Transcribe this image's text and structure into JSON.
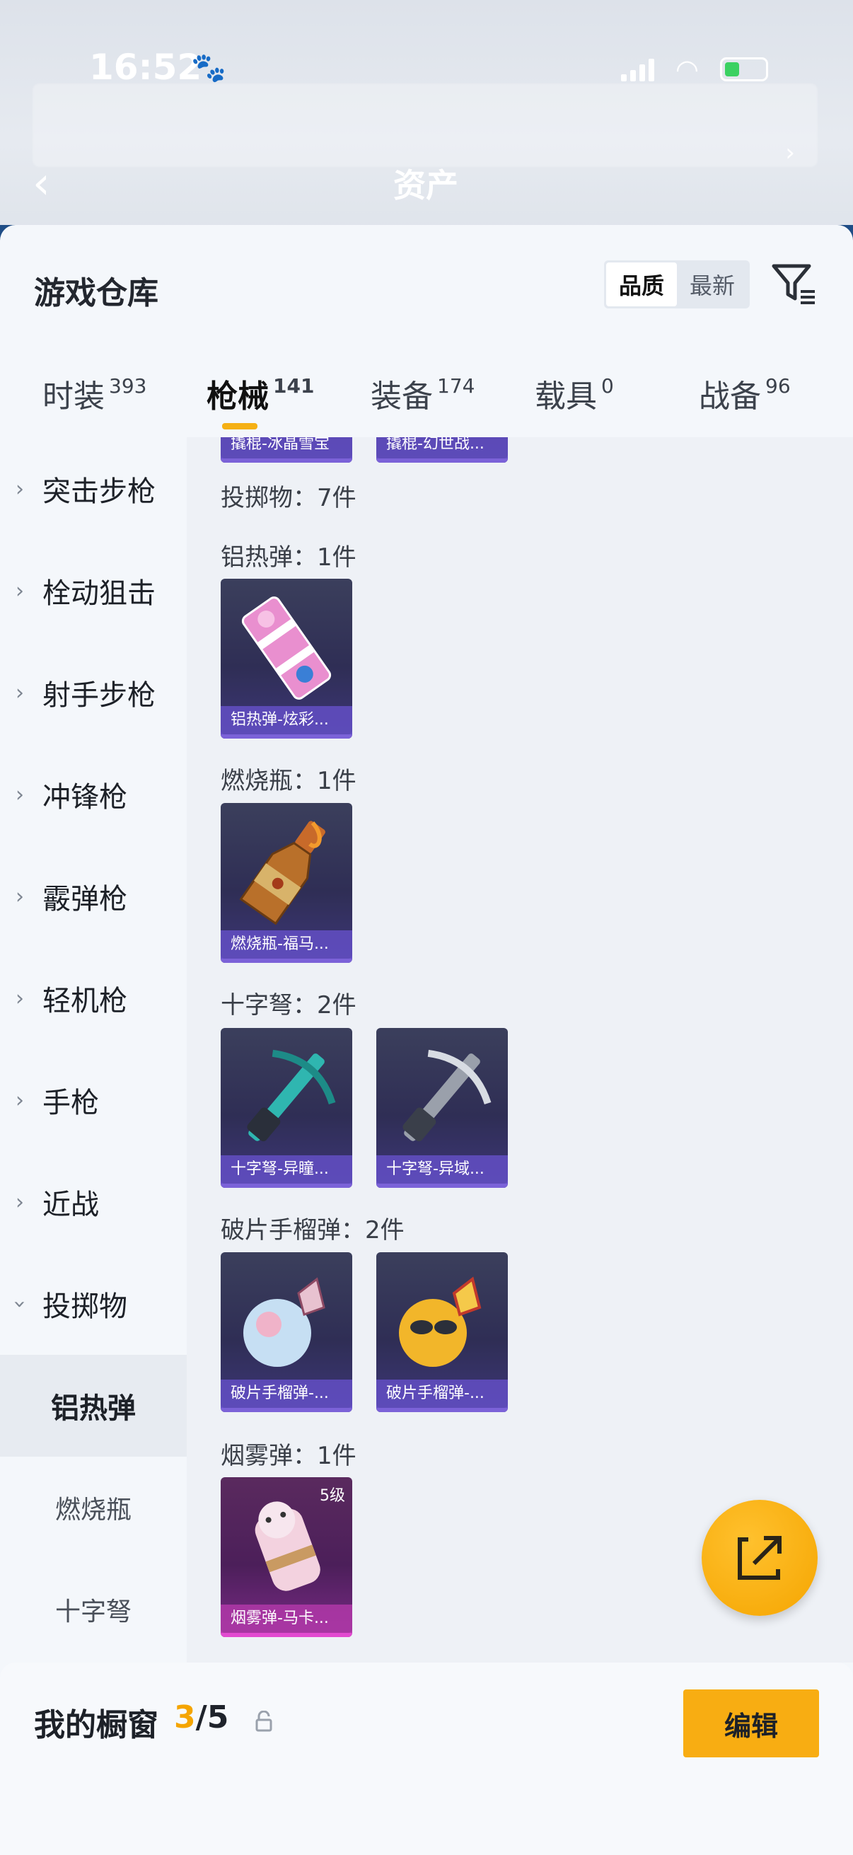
{
  "status_bar": {
    "time": "16:52"
  },
  "header": {
    "title": "资产"
  },
  "sheet": {
    "title": "游戏仓库",
    "sort_options": [
      "品质",
      "最新"
    ],
    "tabs": [
      {
        "label": "时装",
        "count": "393"
      },
      {
        "label": "枪械",
        "count": "141"
      },
      {
        "label": "装备",
        "count": "174"
      },
      {
        "label": "载具",
        "count": "0"
      },
      {
        "label": "战备",
        "count": "96"
      }
    ]
  },
  "sidebar": {
    "categories": [
      "突击步枪",
      "栓动狙击",
      "射手步枪",
      "冲锋枪",
      "霰弹枪",
      "轻机枪",
      "手枪",
      "近战",
      "投掷物"
    ],
    "subcategories": [
      "铝热弹",
      "燃烧瓶",
      "十字弩"
    ]
  },
  "content": {
    "top_cards": [
      "撬棍-冰晶雪宝",
      "撬棍-幻世战..."
    ],
    "group_total": "投掷物：7件",
    "sections": [
      {
        "label": "铝热弹：1件",
        "items": [
          "铝热弹-炫彩..."
        ]
      },
      {
        "label": "燃烧瓶：1件",
        "items": [
          "燃烧瓶-福马..."
        ]
      },
      {
        "label": "十字弩：2件",
        "items": [
          "十字弩-异瞳...",
          "十字弩-异域..."
        ]
      },
      {
        "label": "破片手榴弹：2件",
        "items": [
          "破片手榴弹-...",
          "破片手榴弹-..."
        ]
      },
      {
        "label": "烟雾弹：1件",
        "items": [
          "烟雾弹-马卡..."
        ],
        "level": "5级"
      }
    ]
  },
  "bottom_bar": {
    "label": "我的橱窗",
    "current": "3",
    "separator": "/",
    "total": "5",
    "edit_label": "编辑"
  },
  "colors": {
    "accent": "#f5a500",
    "card_purple": "#3d3678",
    "card_pink": "#7a2a86"
  }
}
